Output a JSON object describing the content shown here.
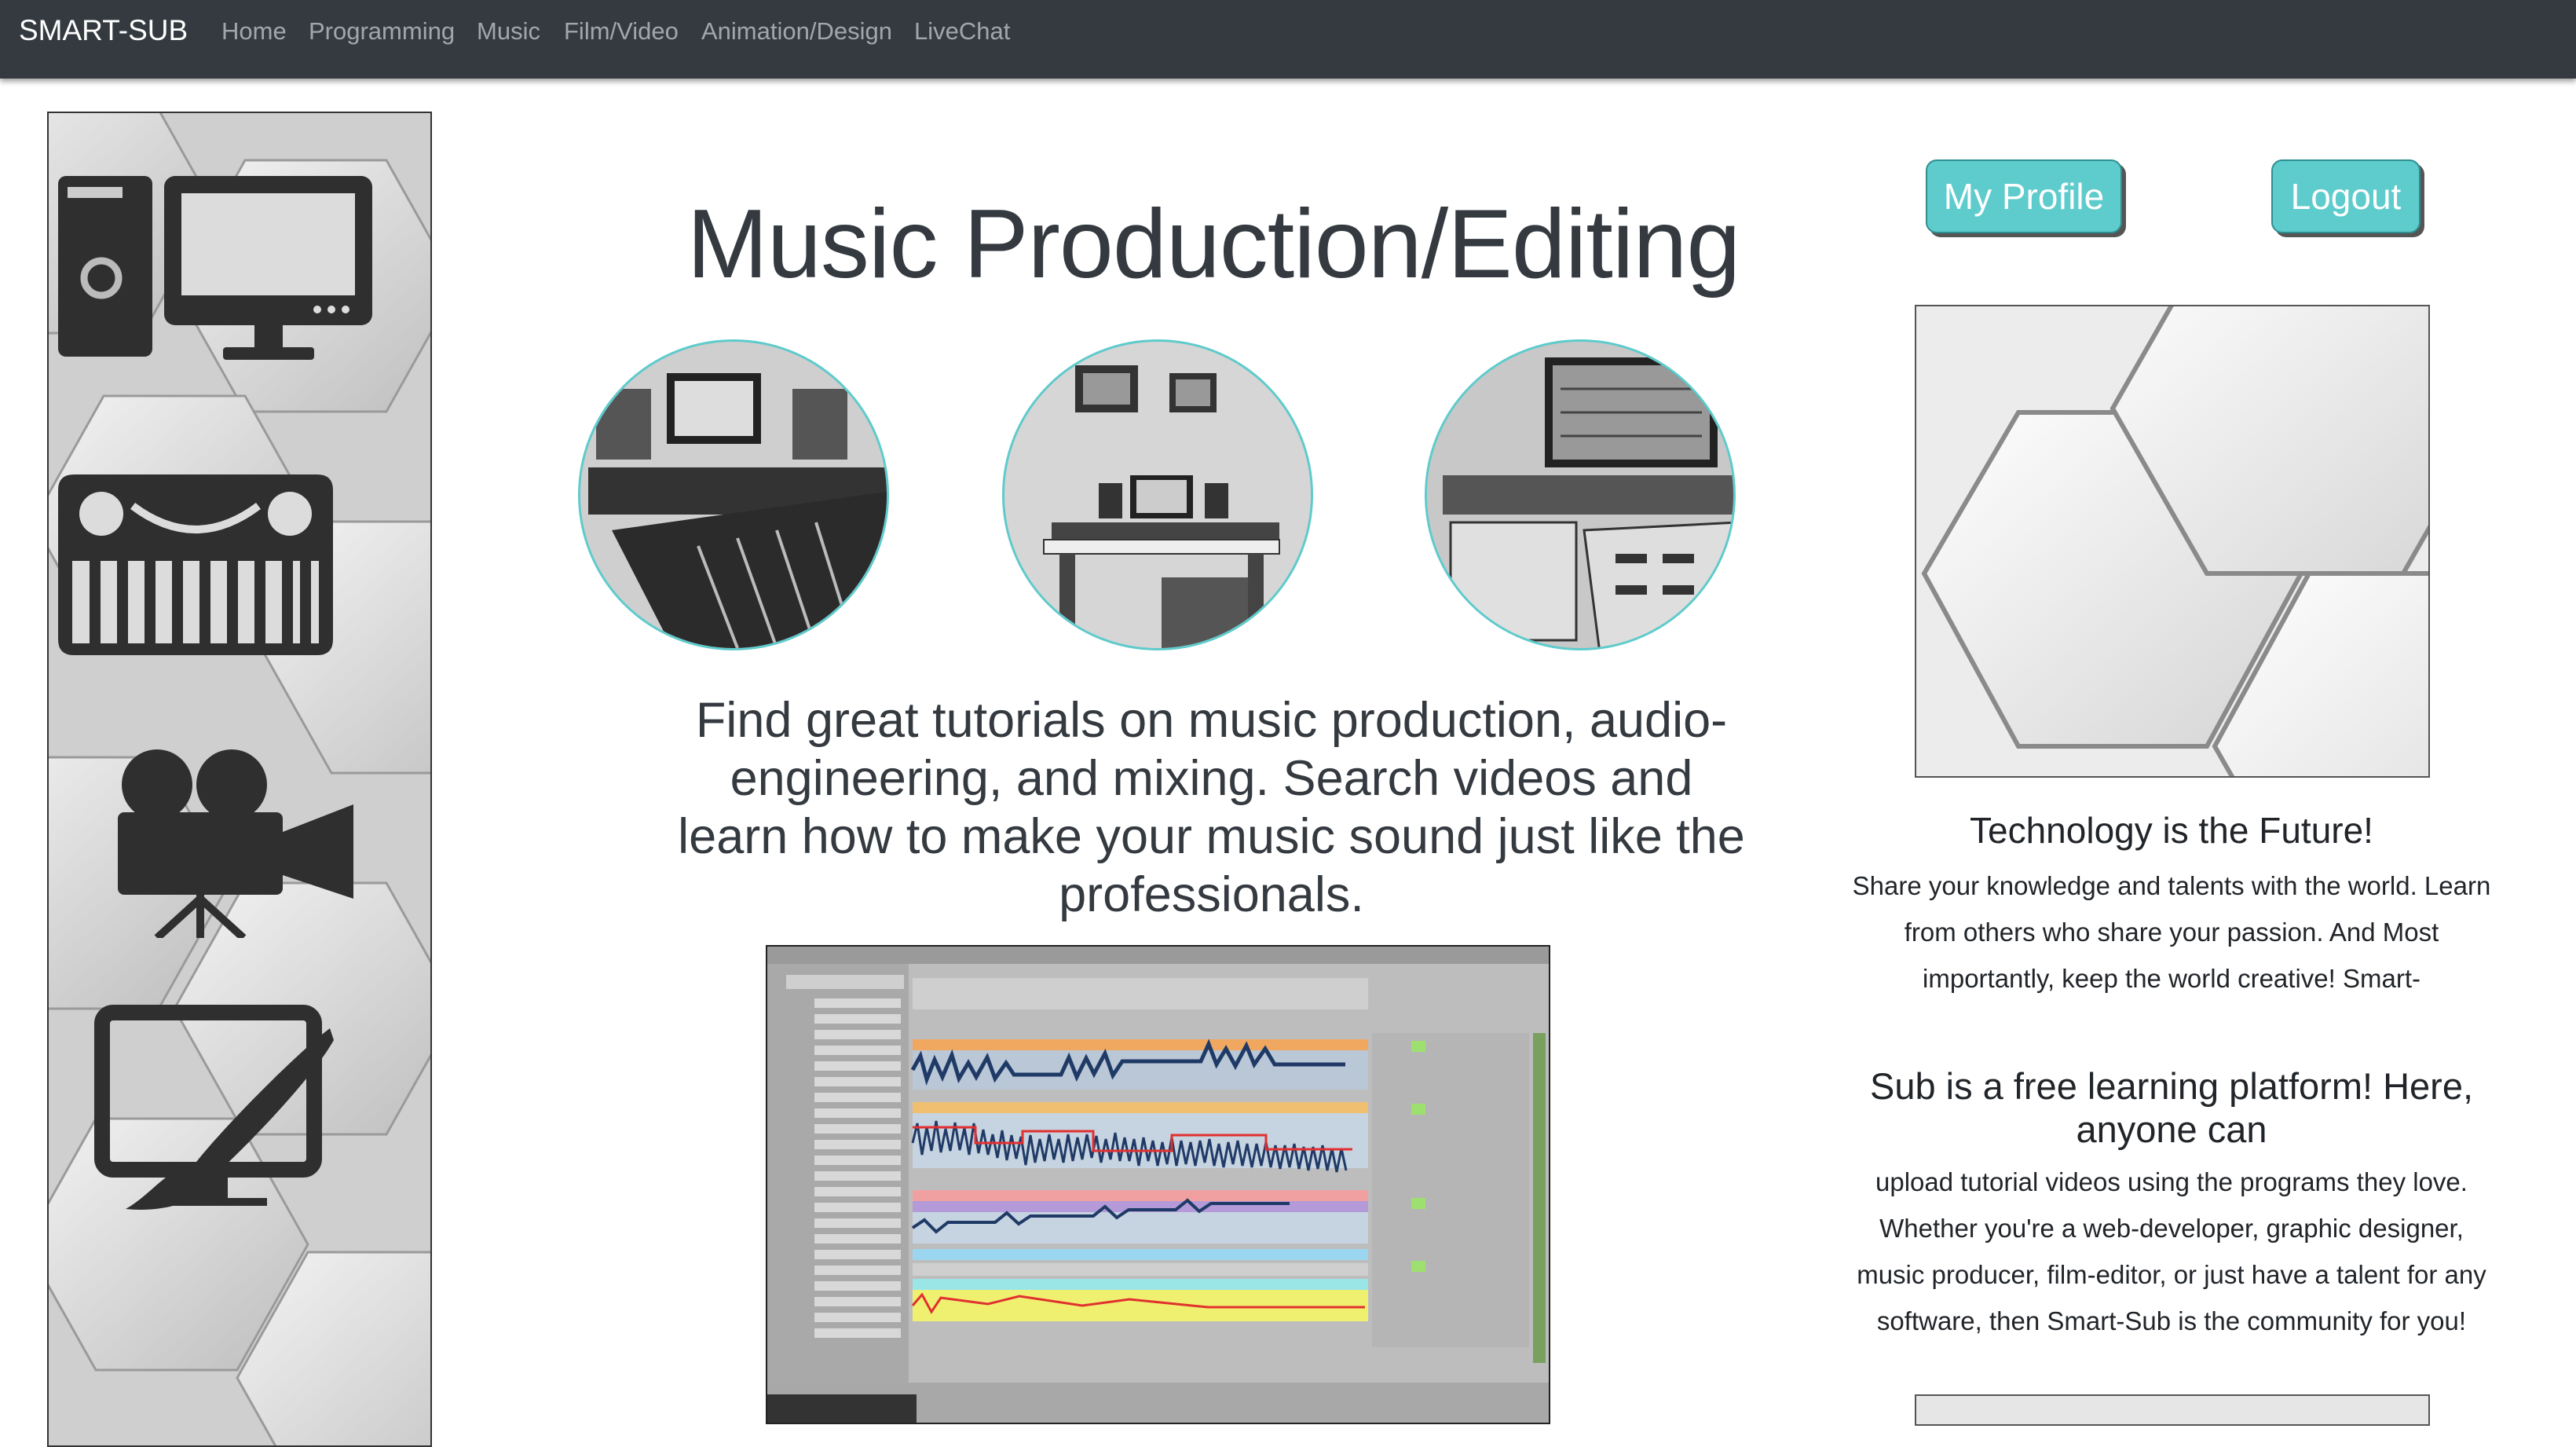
{
  "navbar": {
    "brand": "SMART-SUB",
    "links": [
      "Home",
      "Programming",
      "Music",
      "Film/Video",
      "Animation/Design",
      "LiveChat"
    ]
  },
  "sidebar": {
    "icons": [
      "computer-icon",
      "keyboard-synth-icon",
      "film-camera-icon",
      "design-monitor-brush-icon"
    ]
  },
  "main": {
    "title": "Music Production/Editing",
    "intro": "Find great tutorials on music production, audio-engineering, and mixing. Search videos and learn how to make your music sound just like the professionals."
  },
  "account": {
    "profile_label": "My Profile",
    "logout_label": "Logout"
  },
  "promo": {
    "tagline": "Technology is the Future!",
    "para1": "Share your knowledge and talents with the world. Learn from others who share your passion. And Most importantly, keep the world creative! Smart-",
    "heading2": "Sub is a free learning platform! Here, anyone can",
    "para2": "upload tutorial videos using the programs they love. Whether you're a web-developer, graphic designer, music producer, film-editor, or just have a talent for any software, then Smart-Sub is the community for you!"
  },
  "colors": {
    "navbar": "#343a40",
    "accent": "#5ecbcc",
    "text": "#212529"
  }
}
